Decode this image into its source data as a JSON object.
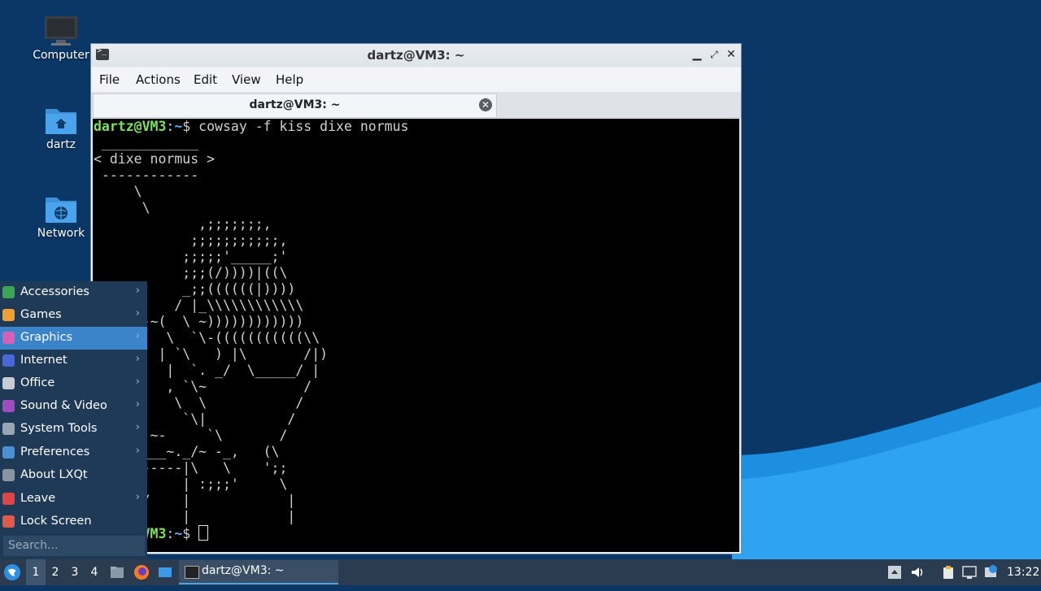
{
  "desktop": {
    "icons": [
      {
        "label": "Computer"
      },
      {
        "label": "dartz"
      },
      {
        "label": "Network"
      }
    ]
  },
  "terminal": {
    "window_title": "dartz@VM3: ~",
    "menu": [
      "File",
      "Actions",
      "Edit",
      "View",
      "Help"
    ],
    "tab_title": "dartz@VM3: ~",
    "prompt_user": "dartz@VM3",
    "prompt_path": "~",
    "command": "cowsay -f kiss dixe normus",
    "output": " ____________\n< dixe normus >\n ------------\n     \\\n      \\\n             ,;;;;;;;,\n            ;;;;;;;;;;;,\n           ;;;;;'_____;'\n           ;;;(/))))|((\\\n           _;;((((((|))))\n          / |_\\\\\\\\\\\\\\\\\\\\\\\\\n    .--~(  \\ ~))))))))))))\n   /     \\  `\\-(((((((((((\\\\\n   |    | `\\   ) |\\       /|)\n    |    |  `. _/  \\_____/ |\n    |    , `\\~            /\n    |     \\  \\           /\n   | `.    `\\|          /\n   |   ~-     `\\       /\n    \\____~._/~ -_,   (\\\n     |-----|\\   \\    ';;\n    |      | :;;;'     \\\n   |  /    |            |\n   |       |            |",
    "last_prompt_user": "dartz@VM3",
    "last_prompt_path": "~"
  },
  "start_menu": {
    "items": [
      {
        "label": "Accessories",
        "icon": "accessories-icon",
        "color": "#3aa655",
        "submenu": true
      },
      {
        "label": "Games",
        "icon": "games-icon",
        "color": "#f0a030",
        "submenu": true
      },
      {
        "label": "Graphics",
        "icon": "graphics-icon",
        "color": "#d65fb8",
        "submenu": true,
        "active": true
      },
      {
        "label": "Internet",
        "icon": "internet-icon",
        "color": "#4a66d8",
        "submenu": true
      },
      {
        "label": "Office",
        "icon": "office-icon",
        "color": "#c8ccd2",
        "submenu": true
      },
      {
        "label": "Sound & Video",
        "icon": "sound-video-icon",
        "color": "#a04bc0",
        "submenu": true
      },
      {
        "label": "System Tools",
        "icon": "system-tools-icon",
        "color": "#9aa6b2",
        "submenu": true
      },
      {
        "label": "Preferences",
        "icon": "preferences-icon",
        "color": "#4c8fd6",
        "submenu": true
      },
      {
        "label": "About LXQt",
        "icon": "about-icon",
        "color": "#8a949e",
        "submenu": false
      },
      {
        "label": "Leave",
        "icon": "leave-icon",
        "color": "#e04444",
        "submenu": true
      },
      {
        "label": "Lock Screen",
        "icon": "lock-icon",
        "color": "#e05a4a",
        "submenu": false
      }
    ],
    "search_placeholder": "Search..."
  },
  "taskbar": {
    "workspaces": [
      "1",
      "2",
      "3",
      "4"
    ],
    "active_workspace": "1",
    "task_label": "dartz@VM3: ~",
    "clock": "13:22"
  },
  "colors": {
    "desktop": "#0b3766",
    "taskbar": "#2b3c50",
    "menu": "#1f3a57",
    "menu_active": "#3c84c9"
  }
}
